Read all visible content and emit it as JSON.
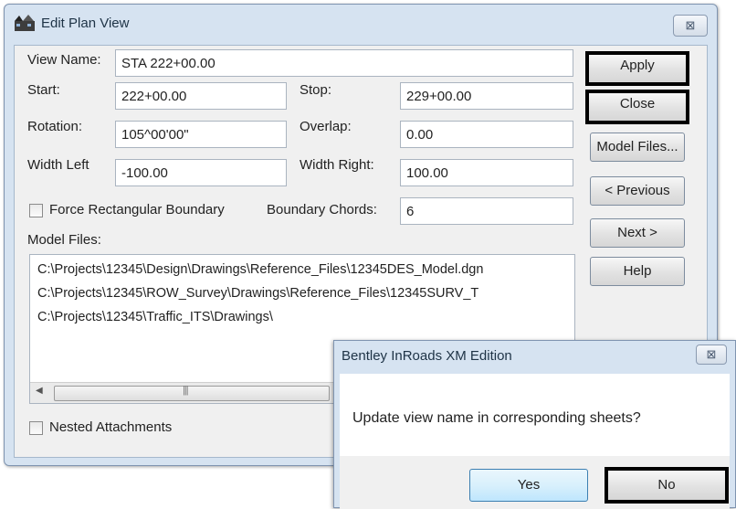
{
  "main_dialog": {
    "title": "Edit Plan View",
    "close_glyph": "⊠",
    "view_name": {
      "label": "View Name:",
      "value": "STA 222+00.00"
    },
    "start": {
      "label": "Start:",
      "value": "222+00.00"
    },
    "stop": {
      "label": "Stop:",
      "value": "229+00.00"
    },
    "rotation": {
      "label": "Rotation:",
      "value": "105^00'00\""
    },
    "overlap": {
      "label": "Overlap:",
      "value": "0.00"
    },
    "width_left": {
      "label": "Width Left",
      "value": "-100.00"
    },
    "width_right": {
      "label": "Width Right:",
      "value": "100.00"
    },
    "force_rect": {
      "label": "Force Rectangular Boundary",
      "checked": false
    },
    "boundary_chords": {
      "label": "Boundary Chords:",
      "value": "6"
    },
    "model_files": {
      "label": "Model Files:",
      "rows": [
        "C:\\Projects\\12345\\Design\\Drawings\\Reference_Files\\12345DES_Model.dgn",
        "C:\\Projects\\12345\\ROW_Survey\\Drawings\\Reference_Files\\12345SURV_T",
        "C:\\Projects\\12345\\Traffic_ITS\\Drawings\\"
      ]
    },
    "nested": {
      "label": "Nested Attachments",
      "checked": false
    },
    "buttons": {
      "apply": "Apply",
      "close": "Close",
      "model_files": "Model Files...",
      "previous": "< Previous",
      "next": "Next >",
      "help": "Help"
    }
  },
  "message_box": {
    "title": "Bentley InRoads XM Edition",
    "close_glyph": "⊠",
    "text": "Update view name in corresponding sheets?",
    "yes": "Yes",
    "no": "No"
  },
  "colors": {
    "frame": "#d6e3f1",
    "client": "#f0f0f0",
    "highlight_border": "#000000"
  },
  "icons": [
    "plan-view-icon",
    "close-icon",
    "scroll-left-arrow-icon",
    "scroll-grip-icon"
  ]
}
